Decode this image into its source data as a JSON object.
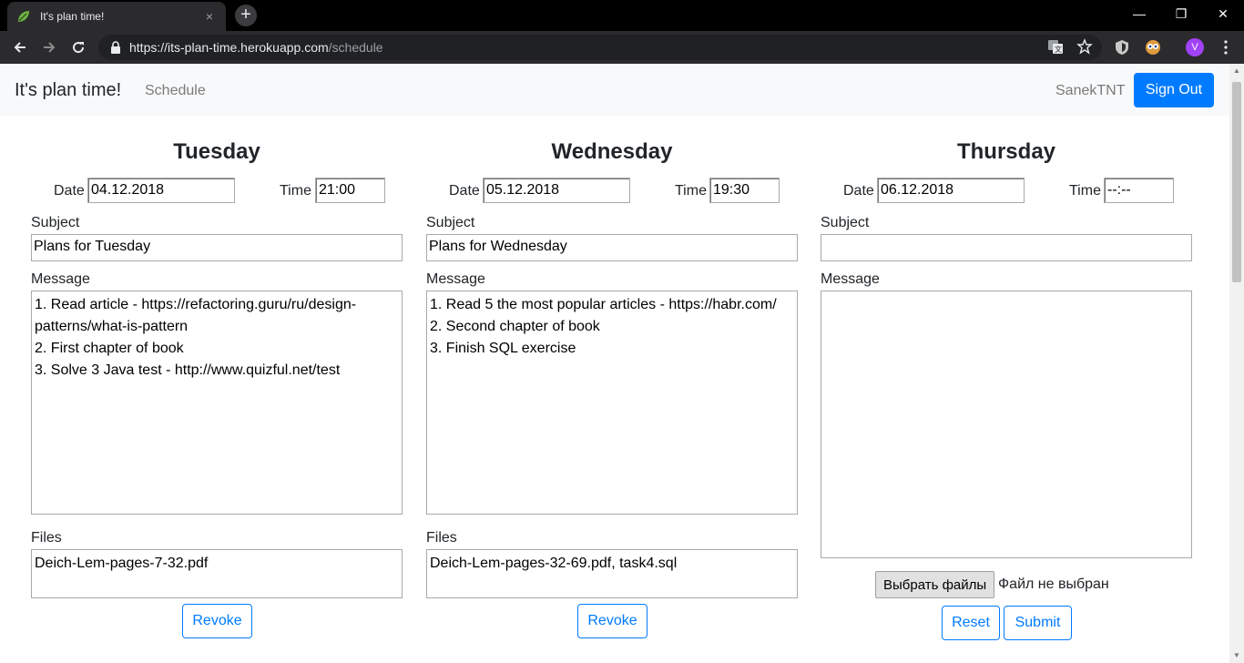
{
  "browser": {
    "tab_title": "It's plan time!",
    "tab_close": "×",
    "new_tab": "+",
    "url_host": "https://its-plan-time.herokuapp.com",
    "url_path": "/schedule",
    "profile_initial": "V",
    "window_controls": [
      "—",
      "❐",
      "✕"
    ]
  },
  "navbar": {
    "brand": "It's plan time!",
    "link_schedule": "Schedule",
    "username": "SanekTNT",
    "signout_label": "Sign Out"
  },
  "labels": {
    "date": "Date",
    "time": "Time",
    "subject": "Subject",
    "message": "Message",
    "files": "Files"
  },
  "days": [
    {
      "title": "Tuesday",
      "date": "04.12.2018",
      "time": "21:00",
      "subject": "Plans for Tuesday",
      "message_lines": [
        "1. Read article - https://refactoring.guru/ru/design-",
        "patterns/what-is-pattern",
        "2. First chapter of book",
        "3. Solve 3 Java test - http://www.quizful.net/test"
      ],
      "files": "Deich-Lem-pages-7-32.pdf",
      "revoke_label": "Revoke"
    },
    {
      "title": "Wednesday",
      "date": "05.12.2018",
      "time": "19:30",
      "subject": "Plans for Wednesday",
      "message_lines": [
        "1. Read 5 the most popular articles - https://habr.com/",
        "2. Second chapter of book",
        "3. Finish SQL exercise"
      ],
      "files": "Deich-Lem-pages-32-69.pdf, task4.sql",
      "revoke_label": "Revoke"
    },
    {
      "title": "Thursday",
      "date": "06.12.2018",
      "time": "--:--",
      "subject": "",
      "message_lines": [],
      "choose_files_label": "Выбрать файлы",
      "no_file_label": "Файл не выбран",
      "reset_label": "Reset",
      "submit_label": "Submit"
    }
  ],
  "colors": {
    "primary": "#007bff",
    "navbar_bg": "#f8f9fa",
    "chrome_dark": "#2b2b2e"
  }
}
